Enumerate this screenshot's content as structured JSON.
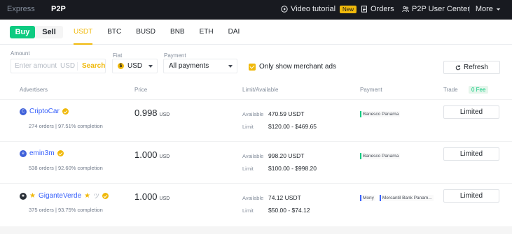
{
  "topnav": {
    "express": "Express",
    "p2p": "P2P",
    "video_tutorial": "Video tutorial",
    "new_badge": "New",
    "orders": "Orders",
    "user_center": "P2P User Center",
    "more": "More"
  },
  "subbar": {
    "buy": "Buy",
    "sell": "Sell",
    "coins": [
      "USDT",
      "BTC",
      "BUSD",
      "BNB",
      "ETH",
      "DAI"
    ],
    "active_coin": "USDT"
  },
  "filters": {
    "amount_label": "Amount",
    "amount_placeholder": "Enter amount",
    "amount_currency": "USD",
    "search": "Search",
    "fiat_label": "Fiat",
    "fiat_value": "USD",
    "payment_label": "Payment",
    "payment_value": "All payments",
    "merchant_only": "Only show merchant ads",
    "refresh": "Refresh"
  },
  "table": {
    "headers": {
      "advertisers": "Advertisers",
      "price": "Price",
      "limit": "Limit/Available",
      "payment": "Payment",
      "trade": "Trade",
      "fee": "0 Fee"
    },
    "available_label": "Available",
    "limit_label": "Limit",
    "rows": [
      {
        "avatar": "C",
        "name": "CriptoCar",
        "stats": "274 orders | 97.51% completion",
        "price": "0.998",
        "unit": "USD",
        "available": "470.59 USDT",
        "limit": "$120.00 - $469.65",
        "payments": [
          "Banesco Panama"
        ],
        "action": "Limited"
      },
      {
        "avatar": "e",
        "name": "emin3m",
        "stats": "538 orders | 92.60% completion",
        "price": "1.000",
        "unit": "USD",
        "available": "998.20 USDT",
        "limit": "$100.00 - $998.20",
        "payments": [
          "Banesco Panama"
        ],
        "action": "Limited"
      },
      {
        "avatar": "★",
        "name": "GiganteVerde",
        "stats": "375 orders | 93.75% completion",
        "price": "1.000",
        "unit": "USD",
        "available": "74.12 USDT",
        "limit": "$50.00 - $74.12",
        "payments": [
          "Mony",
          "Mercantil Bank Panam..."
        ],
        "action": "Limited"
      }
    ]
  },
  "colors": {
    "brand": "#f0b90b",
    "buy": "#0ecb81",
    "nav_bg": "#181a20",
    "link": "#3861fb"
  }
}
